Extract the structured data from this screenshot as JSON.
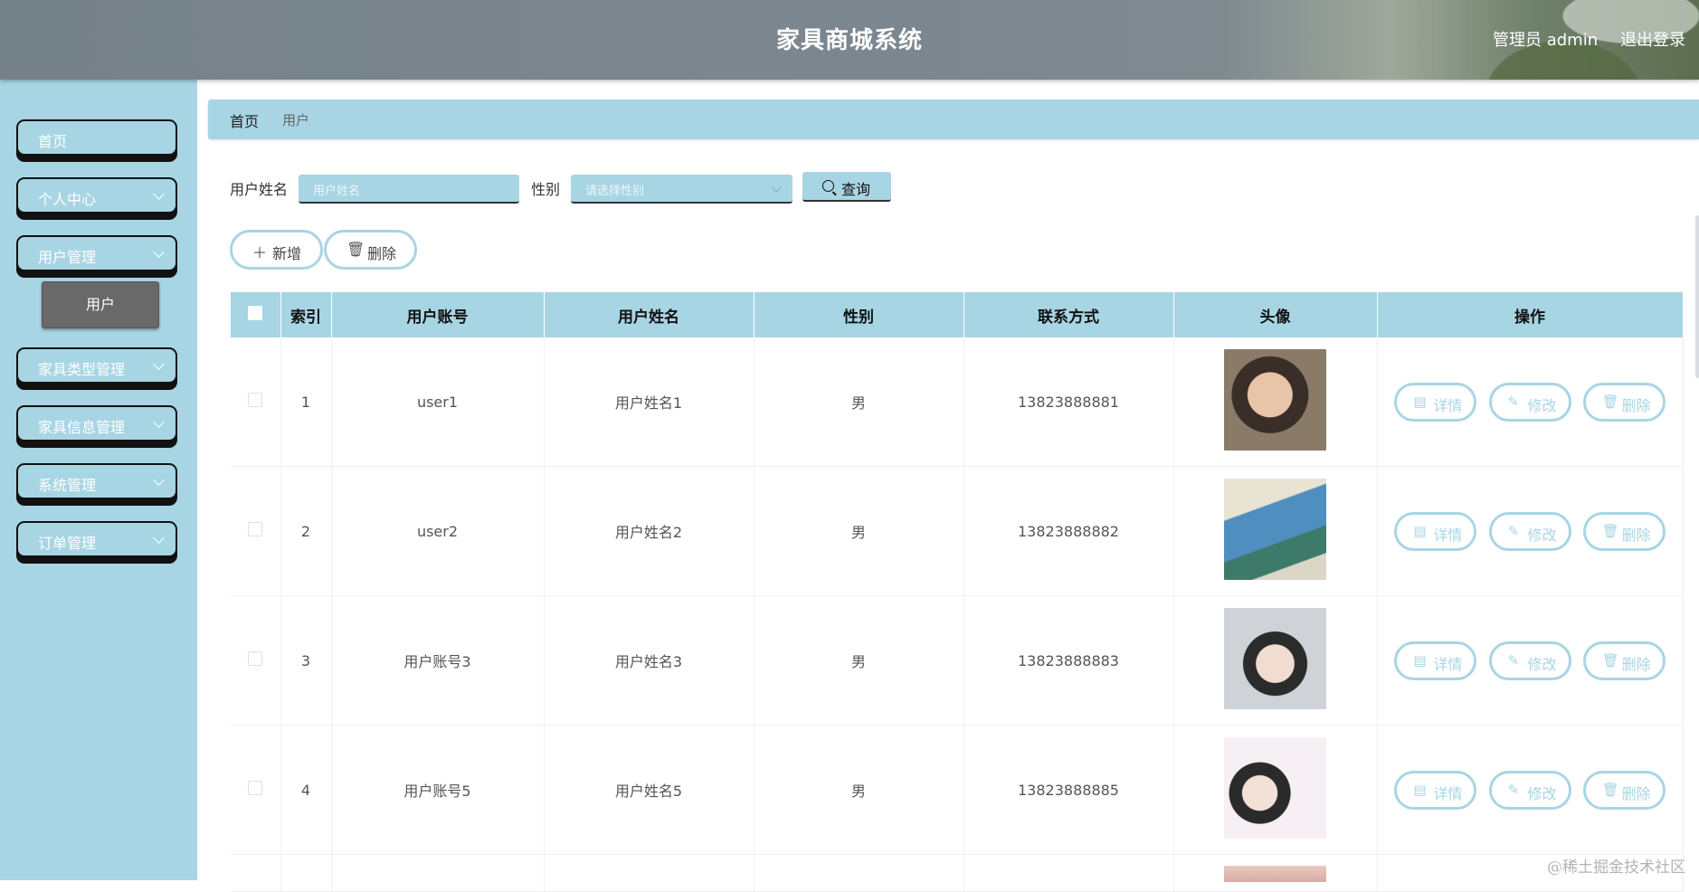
{
  "header": {
    "title": "家具商城系统",
    "admin_label": "管理员 admin",
    "logout_label": "退出登录"
  },
  "sidebar": {
    "items": [
      {
        "label": "首页",
        "has_arrow": false
      },
      {
        "label": "个人中心",
        "has_arrow": true
      },
      {
        "label": "用户管理",
        "has_arrow": true
      },
      {
        "label": "家具类型管理",
        "has_arrow": true
      },
      {
        "label": "家具信息管理",
        "has_arrow": true
      },
      {
        "label": "系统管理",
        "has_arrow": true
      },
      {
        "label": "订单管理",
        "has_arrow": true
      }
    ],
    "sub_item": "用户"
  },
  "breadcrumb": {
    "home": "首页",
    "separator": "/",
    "current": "用户"
  },
  "search": {
    "name_label": "用户姓名",
    "name_placeholder": "用户姓名",
    "gender_label": "性别",
    "gender_placeholder": "请选择性别",
    "query_label": "查询"
  },
  "actions": {
    "add_label": "新增",
    "delete_label": "删除"
  },
  "table": {
    "headers": [
      "索引",
      "用户账号",
      "用户姓名",
      "性别",
      "联系方式",
      "头像",
      "操作"
    ],
    "rows": [
      {
        "index": "1",
        "account": "user1",
        "name": "用户姓名1",
        "gender": "男",
        "phone": "13823888881",
        "avatar": "avatar-photo-1"
      },
      {
        "index": "2",
        "account": "user2",
        "name": "用户姓名2",
        "gender": "男",
        "phone": "13823888882",
        "avatar": "avatar-photo-2"
      },
      {
        "index": "3",
        "account": "用户账号3",
        "name": "用户姓名3",
        "gender": "男",
        "phone": "13823888883",
        "avatar": "avatar-photo-3"
      },
      {
        "index": "4",
        "account": "用户账号5",
        "name": "用户姓名5",
        "gender": "男",
        "phone": "13823888885",
        "avatar": "avatar-photo-4"
      }
    ],
    "op_labels": {
      "detail": "详情",
      "edit": "修改",
      "delete": "删除"
    }
  },
  "colors": {
    "accent": "#a8d5e4",
    "header": "#7d878f",
    "sub_item": "#696969"
  },
  "watermark": "@稀土掘金技术社区"
}
